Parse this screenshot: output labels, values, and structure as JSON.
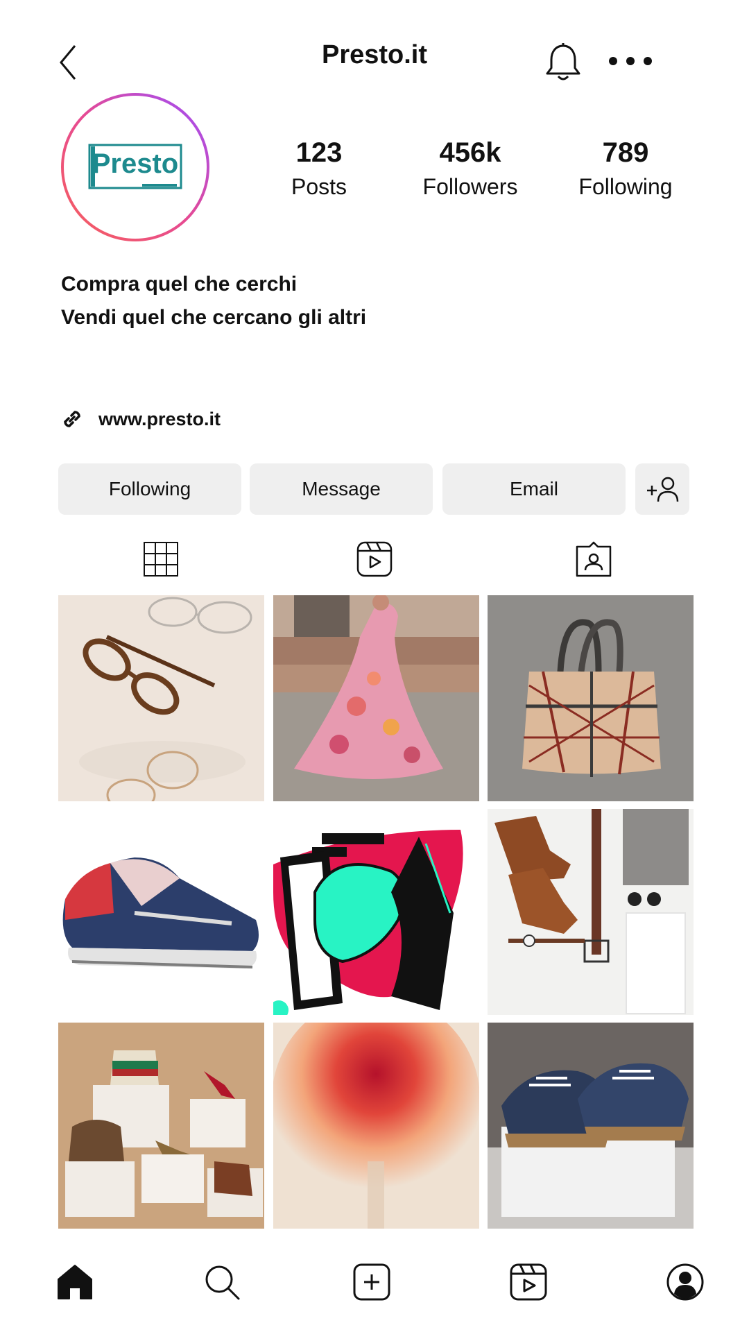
{
  "header": {
    "title": "Presto.it"
  },
  "profile": {
    "logo_text": "Presto",
    "stats": {
      "posts": {
        "value": "123",
        "label": "Posts"
      },
      "followers": {
        "value": "456k",
        "label": "Followers"
      },
      "following": {
        "value": "789",
        "label": "Following"
      }
    },
    "bio": {
      "line1": "Compra quel che cerchi",
      "line2": "Vendi quel che cercano gli altri"
    },
    "link": "www.presto.it"
  },
  "actions": {
    "following_label": "Following",
    "message_label": "Message",
    "email_label": "Email"
  },
  "grid": {
    "posts": [
      "glasses",
      "floral-dress",
      "plaid-handbag",
      "sneaker",
      "illustration-sweater",
      "boots-flatlay",
      "bags-and-heels",
      "blurred-flower",
      "espadrille-sneakers"
    ]
  },
  "icons": {
    "back": "chevron-left-icon",
    "bell": "bell-icon",
    "more": "more-horizontal-icon",
    "link": "link-icon",
    "add_person": "add-person-icon",
    "grid": "grid-icon",
    "reels": "reels-icon",
    "tagged": "tagged-icon",
    "home": "home-icon",
    "search": "search-icon",
    "create": "plus-square-icon",
    "profile": "profile-icon"
  },
  "colors": {
    "logo_teal": "#1d8a8e",
    "ring_start": "#f7605a",
    "ring_end": "#9b4dff",
    "button_bg": "#efefef"
  }
}
